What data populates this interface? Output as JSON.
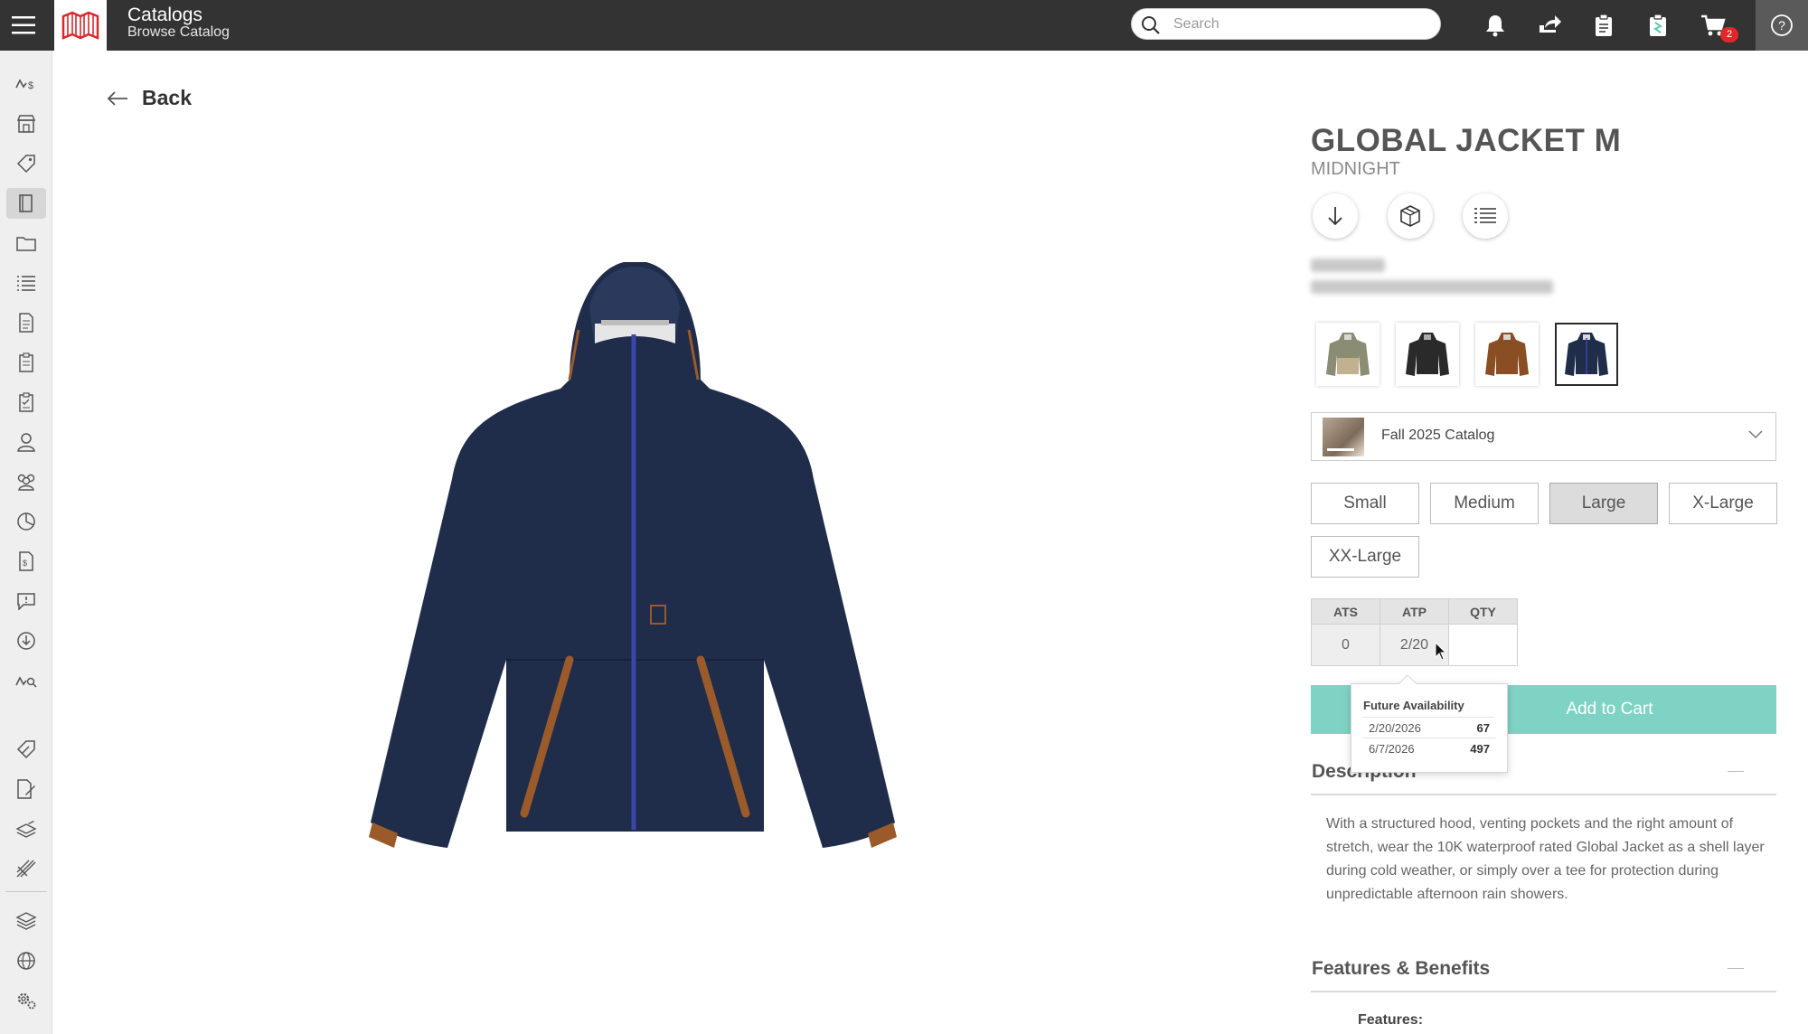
{
  "topbar": {
    "title": "Catalogs",
    "subtitle": "Browse Catalog",
    "search_placeholder": "Search",
    "cart_count": "2",
    "icons": [
      "menu-icon",
      "logo",
      "bell-icon",
      "share-icon",
      "clipboard-icon",
      "clipboard-check-icon",
      "cart-icon",
      "help-icon"
    ]
  },
  "sidebar": {
    "items": [
      "analytics-icon",
      "store-icon",
      "tag-icon",
      "catalog-icon",
      "folder-icon",
      "list-icon",
      "document-icon",
      "clipboard-icon",
      "checklist-icon",
      "user-icon",
      "users-icon",
      "pie-chart-icon",
      "invoice-icon",
      "message-icon",
      "download-icon",
      "trend-icon",
      "tag-edit-icon",
      "document-edit-icon",
      "stack-edit-icon",
      "tools-icon",
      "layers-icon",
      "globe-icon",
      "settings-icon"
    ],
    "active": "catalog-icon"
  },
  "back_label": "Back",
  "product": {
    "name": "GLOBAL JACKET M",
    "color": "MIDNIGHT",
    "swatches": [
      "olive/khaki",
      "black",
      "brown",
      "midnight"
    ],
    "selected_swatch": "midnight",
    "image_colors": {
      "jacket": "#1f2c4a",
      "zip": "#3b46a8",
      "trim": "#9a5a2a"
    }
  },
  "catalog": {
    "label": "Fall 2025 Catalog"
  },
  "sizes": [
    "Small",
    "Medium",
    "Large",
    "X-Large",
    "XX-Large"
  ],
  "selected_size": "Large",
  "inventory": {
    "headers": [
      "ATS",
      "ATP",
      "QTY"
    ],
    "ats": "0",
    "atp": "2/20",
    "qty": ""
  },
  "add_to_cart_label": "Add to Cart",
  "future_availability": {
    "title": "Future Availability",
    "rows": [
      {
        "date": "2/20/2026",
        "qty": "67"
      },
      {
        "date": "6/7/2026",
        "qty": "497"
      }
    ]
  },
  "description": {
    "heading": "Description",
    "text": "With a structured hood, venting pockets and the right amount of stretch, wear the 10K waterproof rated Global Jacket as a shell layer during cold weather, or simply over a tee for protection during unpredictable afternoon rain showers."
  },
  "features": {
    "heading": "Features & Benefits",
    "subheading": "Features:"
  },
  "colors": {
    "topbar": "#333333",
    "accent": "#7fd3c4",
    "badge": "#e3262b"
  }
}
